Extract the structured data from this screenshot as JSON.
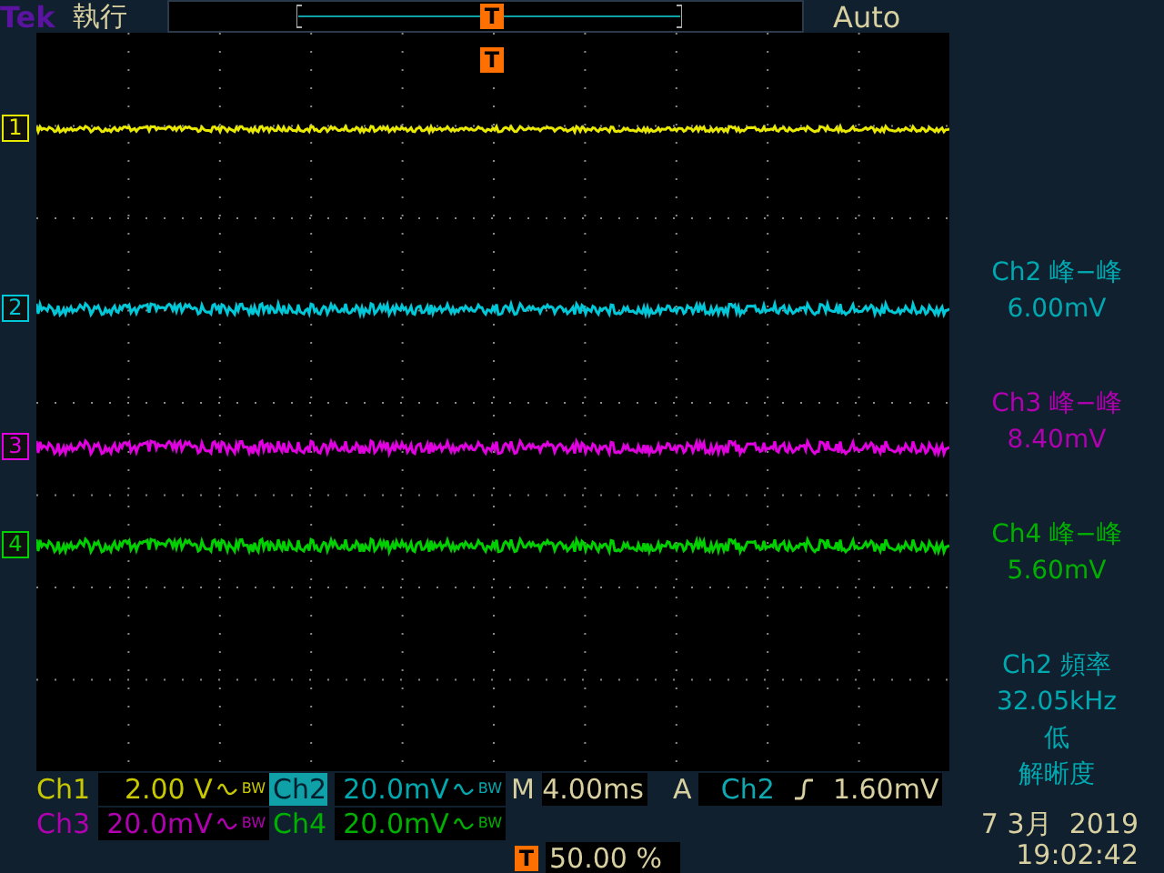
{
  "header": {
    "brand": "Tek",
    "run_state": "執行",
    "trigger_mode": "Auto"
  },
  "trigger_marker": "T",
  "record_marker": "T",
  "markers": [
    {
      "label": "1",
      "color": "#e8e800"
    },
    {
      "label": "2",
      "color": "#00c8d8"
    },
    {
      "label": "3",
      "color": "#e000e0"
    },
    {
      "label": "4",
      "color": "#00d000"
    }
  ],
  "measurements": [
    {
      "title": "Ch2 峰−峰",
      "value": "6.00mV",
      "color": "#00a8b0"
    },
    {
      "title": "Ch3 峰−峰",
      "value": "8.40mV",
      "color": "#b000b0"
    },
    {
      "title": "Ch4 峰−峰",
      "value": "5.60mV",
      "color": "#00b000"
    }
  ],
  "frequency": {
    "title": "Ch2 頻率",
    "value": "32.05kHz",
    "note_1": "低",
    "note_2": "解晰度",
    "color": "#00a8b0"
  },
  "channels": [
    {
      "name": "Ch1",
      "scale": "2.00 V",
      "bw": "BW",
      "color": "#c8c800",
      "selected": false
    },
    {
      "name": "Ch2",
      "scale": "20.0mV",
      "bw": "BW",
      "color": "#00a8b0",
      "selected": true
    },
    {
      "name": "Ch3",
      "scale": "20.0mV",
      "bw": "BW",
      "color": "#b000b0",
      "selected": false
    },
    {
      "name": "Ch4",
      "scale": "20.0mV",
      "bw": "BW",
      "color": "#00b000",
      "selected": false
    }
  ],
  "timebase": {
    "label": "M",
    "value": "4.00ms"
  },
  "trigger": {
    "label": "A",
    "source": "Ch2",
    "level": "1.60mV"
  },
  "trigger_position": {
    "icon_label": "T",
    "value": "50.00 %"
  },
  "date": "7 3月  2019",
  "time": "19:02:42"
}
